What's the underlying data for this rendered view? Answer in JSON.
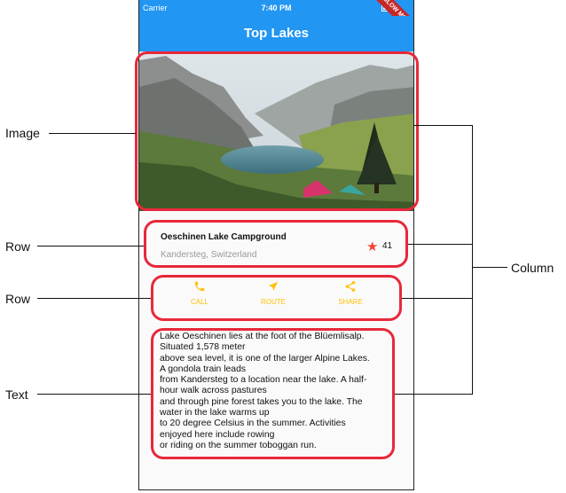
{
  "status_bar": {
    "carrier": "Carrier",
    "time": "7:40 PM"
  },
  "debug_banner": "SLOW MODE",
  "app_bar": {
    "title": "Top Lakes"
  },
  "title_section": {
    "name": "Oeschinen Lake Campground",
    "location": "Kandersteg, Switzerland",
    "star_count": "41"
  },
  "buttons": [
    {
      "label": "CALL",
      "icon": "phone-icon"
    },
    {
      "label": "ROUTE",
      "icon": "navigation-icon"
    },
    {
      "label": "SHARE",
      "icon": "share-icon"
    }
  ],
  "description_lines": [
    "Lake Oeschinen lies at the foot of the Blüemlisalp.",
    "Situated 1,578 meter",
    "above sea level, it is one of the larger Alpine Lakes.",
    "A gondola train leads",
    "from Kandersteg to a location near the lake. A half-",
    "hour walk across pastures",
    "and through pine forest takes you to the lake. The",
    "water in the lake warms up",
    "to 20 degree Celsius in the summer. Activities",
    "enjoyed here include rowing",
    "or riding on the summer toboggan run."
  ],
  "annotations": {
    "image": "Image",
    "row1": "Row",
    "row2": "Row",
    "text": "Text",
    "column": "Column"
  },
  "colors": {
    "primary": "#2196F3",
    "accent": "#FFC107",
    "star": "#f44336",
    "annotation": "#e8283a"
  }
}
